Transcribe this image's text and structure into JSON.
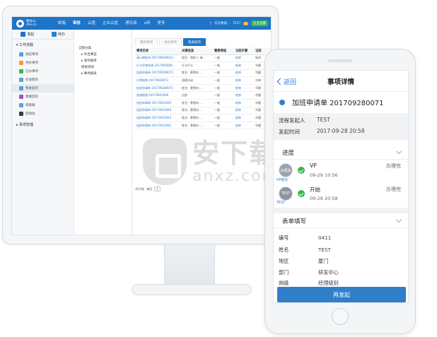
{
  "desktop": {
    "logo_text": "要办公",
    "logo_sub": "zhe.cn",
    "nav": [
      "邮箱",
      "审批",
      "云盘",
      "企业云盘",
      "通讯录",
      "e网",
      "更多"
    ],
    "nav_active_index": 1,
    "top_right": {
      "user_text": "华云数据...",
      "test_label": "TEST",
      "badge": "8",
      "action_label": "企业设置"
    },
    "sidebar_tabs": [
      "发起",
      "待办"
    ],
    "group_title": "工作流程",
    "side_items": [
      {
        "label": "发起事项",
        "color": "#5aa0e0"
      },
      {
        "label": "待办事项",
        "color": "#f39c32"
      },
      {
        "label": "已办事项",
        "color": "#3bb54a"
      },
      {
        "label": "抄送我的",
        "color": "#5aa0e0"
      },
      {
        "label": "我发起的",
        "color": "#5aa0e0"
      },
      {
        "label": "我撤回的",
        "color": "#9b59b6"
      },
      {
        "label": "草稿箱",
        "color": "#5aa0e0"
      },
      {
        "label": "回收站",
        "color": "#2c3e50"
      }
    ],
    "side_active_index": 4,
    "group_title_2": "事项管理",
    "tree": [
      "全部分类",
      "▸ 外出事宜",
      "▸ 请示报审",
      "  研发测试",
      "▸ 事务报表"
    ],
    "tabs": [
      "我的事项",
      "待办事项",
      "我发起的"
    ],
    "tab_active_index": 2,
    "grid_headers": [
      "事项名称",
      "关键信息",
      "重要等级",
      "当前步骤",
      "当前"
    ],
    "grid_rows": [
      [
        "请示审批单 201709280012",
        "报名：审批人 请...",
        "一般",
        "结束",
        "和邦"
      ],
      [
        "打卡异常申请 2017092800...",
        "打卡打卡",
        "一般",
        "结束",
        "华磨"
      ],
      [
        "加班申请单 201709280073",
        "姓名：黄雪冉 ...",
        "一般",
        "结束",
        "华磨"
      ],
      [
        "日常报销 20170928072",
        "团建活动",
        "一般",
        "结束",
        "方梅"
      ],
      [
        "加班申请单 201709280071",
        "姓名：黄雪冉 ...",
        "一般",
        "结束",
        "华磨"
      ],
      [
        "差旅报销 20170922048",
        "出差",
        "一般",
        "结束",
        "华磨"
      ],
      [
        "加班申请单 20170922045",
        "姓名：黄雪冉 ...",
        "一般",
        "结束",
        "华磨"
      ],
      [
        "加班申请单 20170922044",
        "姓名：黄雪冉 ...",
        "一般",
        "结束",
        "华磨"
      ],
      [
        "加班申请单 20170922043",
        "姓名：黄雪冉 ...",
        "一般",
        "结束",
        "华磨"
      ],
      [
        "加班申请单 20170922042",
        "姓名：黄雪冉 ...",
        "一般",
        "结束",
        "华磨"
      ]
    ],
    "pager_total": "共10条",
    "pager_size": "每页",
    "pager_page": "1"
  },
  "watermark": {
    "cn": "安下载",
    "en": "anxz.com"
  },
  "phone": {
    "back_label": "返回",
    "title": "事项详情",
    "request_title": "加班申请单 201709280071",
    "initiator_label": "流程发起人",
    "initiator_value": "TEST",
    "time_label": "发起时间",
    "time_value": "2017-09-28 20:58",
    "progress_title": "进度",
    "steps": [
      {
        "avatar": "办理完",
        "sub": "VP组长",
        "name": "VP",
        "time": "09-29 10:56",
        "status": "办理完"
      },
      {
        "avatar": "TEST",
        "sub": "TEST",
        "name": "开始",
        "time": "09-28 20:58",
        "status": "办理完"
      }
    ],
    "form_title": "表单填写",
    "form_rows": [
      {
        "label": "编号",
        "value": "0411"
      },
      {
        "label": "姓名",
        "value": "TEST"
      },
      {
        "label": "地区",
        "value": "厦门"
      },
      {
        "label": "部门",
        "value": "研发中心"
      },
      {
        "label": "岗级",
        "value": "经理级别"
      }
    ],
    "submit_label": "再发起"
  }
}
